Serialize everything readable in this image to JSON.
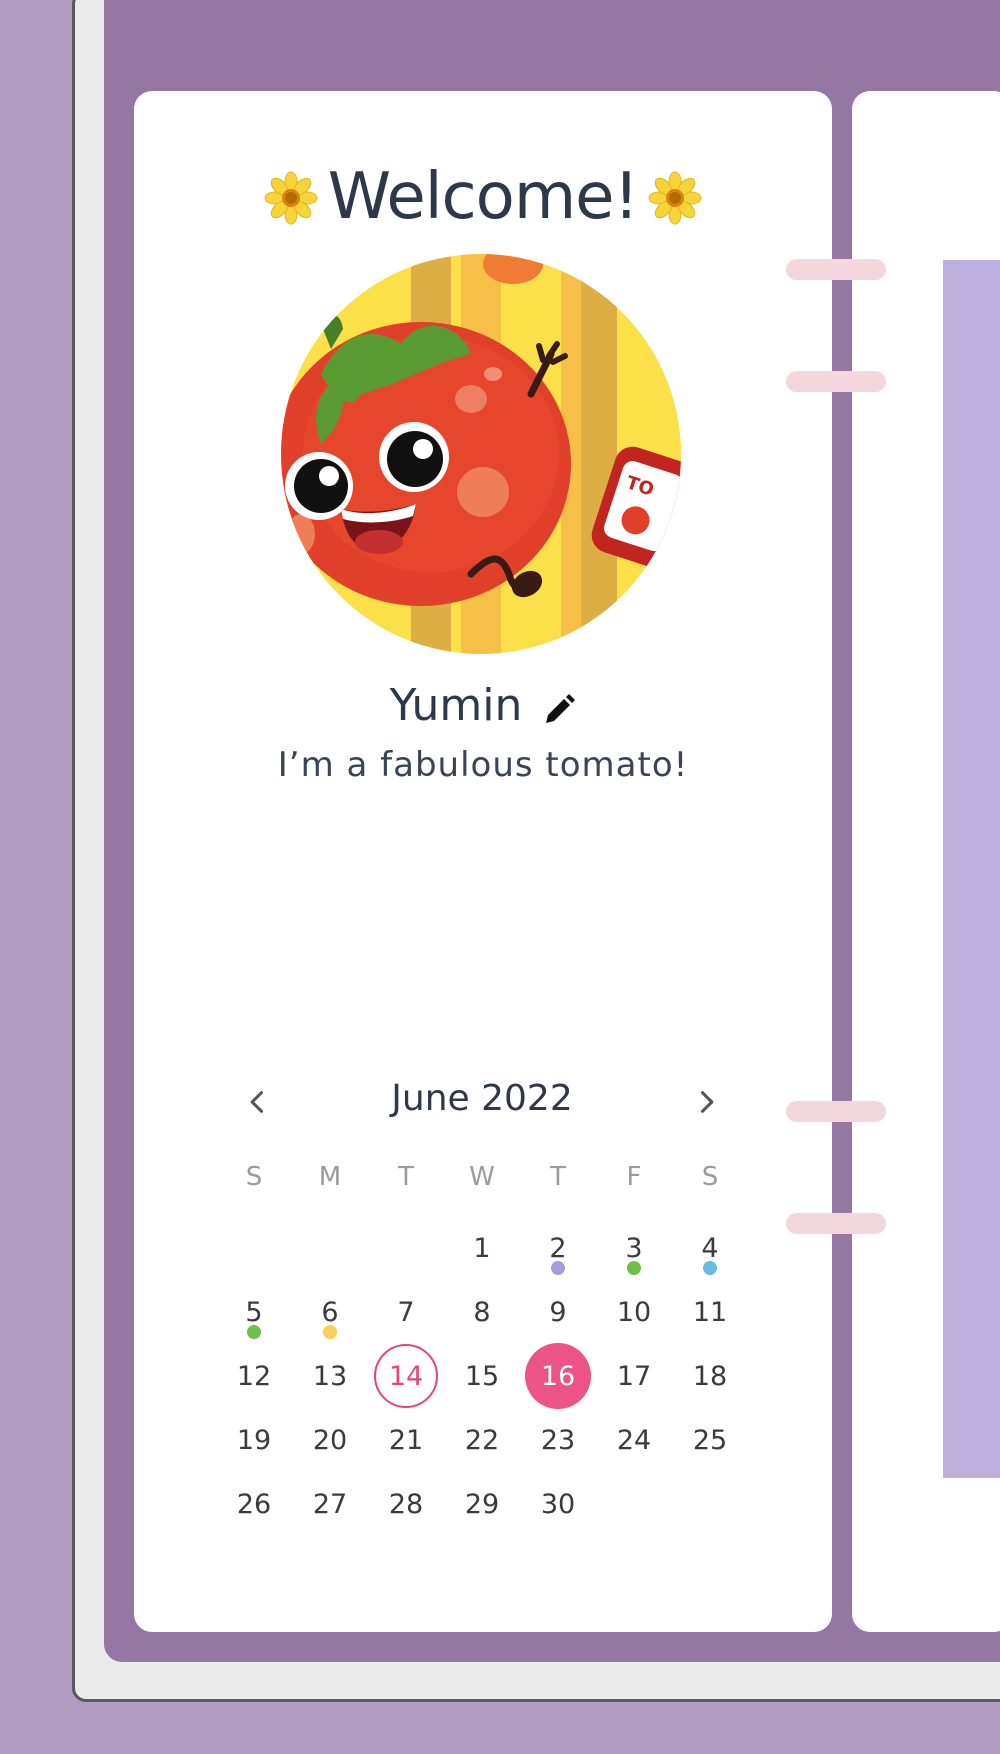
{
  "profile": {
    "welcome": "Welcome!",
    "name": "Yumin",
    "bio": "I’m a fabulous tomato!",
    "avatar_label": "TO"
  },
  "calendar": {
    "title": "June 2022",
    "weekdays": [
      "S",
      "M",
      "T",
      "W",
      "T",
      "F",
      "S"
    ],
    "first_weekday_index": 3,
    "days_in_month": 30,
    "today": 14,
    "selected": 16,
    "event_dots": [
      {
        "day": 2,
        "color": "#a899e0"
      },
      {
        "day": 3,
        "color": "#6cc04a"
      },
      {
        "day": 4,
        "color": "#6bbbe6"
      },
      {
        "day": 5,
        "color": "#6cc04a"
      },
      {
        "day": 6,
        "color": "#f8cf5a"
      }
    ]
  },
  "colors": {
    "binder": "#9577a3",
    "accent": "#ec5487",
    "ring": "#f4d7dc",
    "panel": "#bdb0dc"
  }
}
